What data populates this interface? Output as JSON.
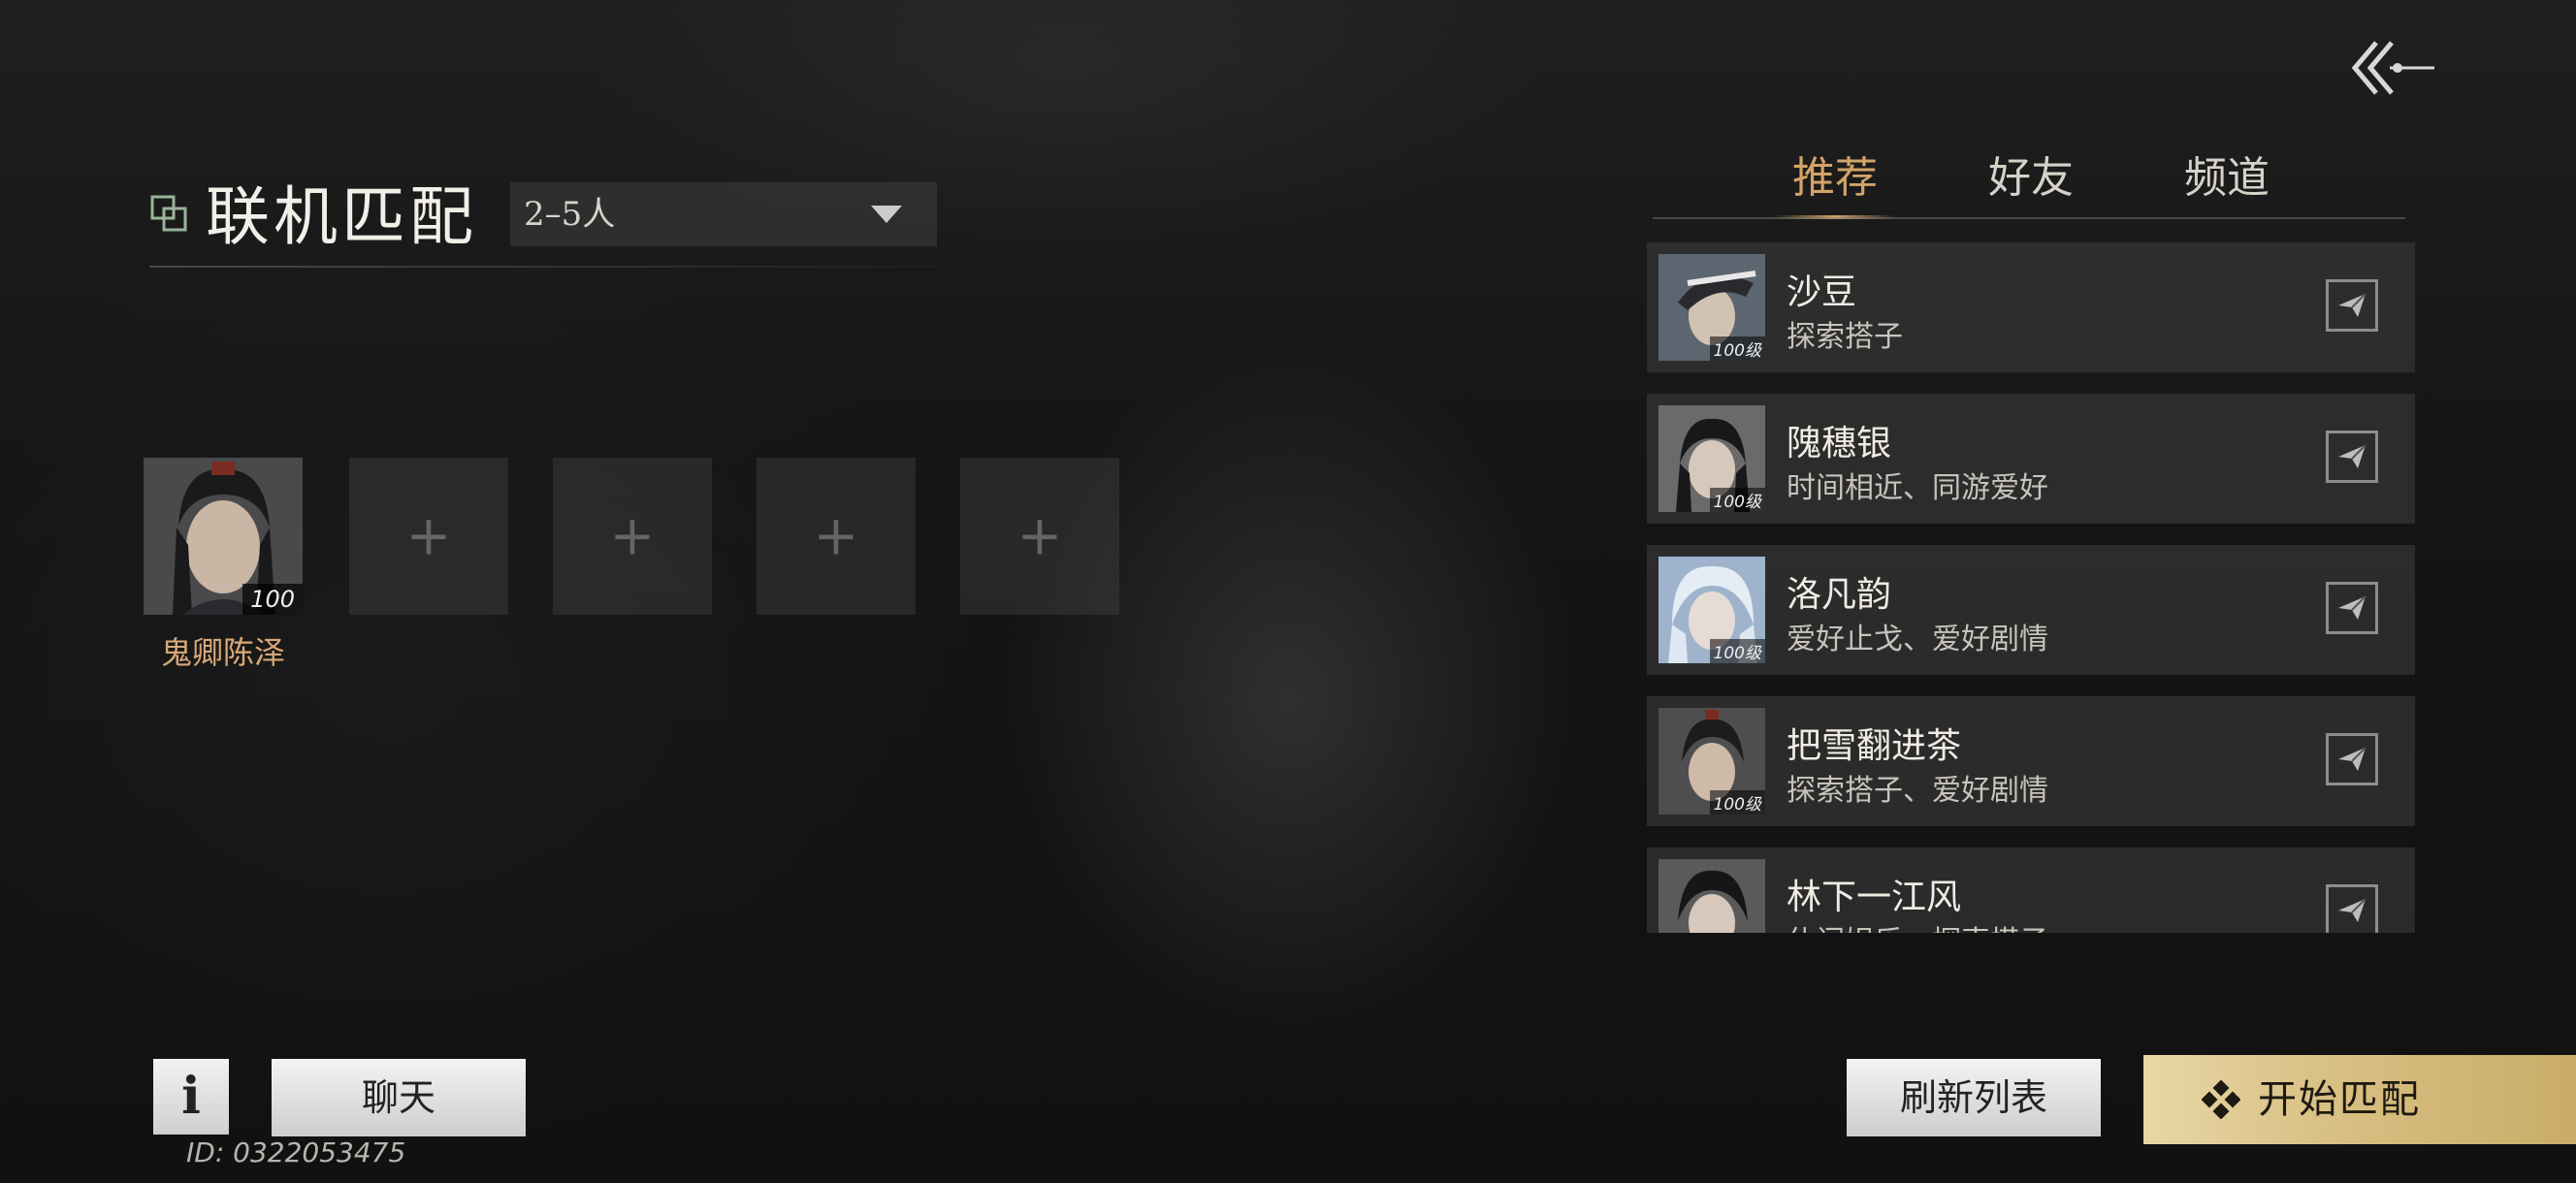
{
  "mode": {
    "title": "联机匹配",
    "party_size": "2–5人"
  },
  "party": {
    "leader_name": "鬼卿陈泽",
    "leader_level": "100",
    "empty_slot_symbol": "+"
  },
  "tabs": [
    {
      "label": "推荐",
      "active": true
    },
    {
      "label": "好友",
      "active": false
    },
    {
      "label": "频道",
      "active": false
    }
  ],
  "recommendations": [
    {
      "name": "沙豆",
      "tags": "探索搭子",
      "level": "100级"
    },
    {
      "name": "隗穗银",
      "tags": "时间相近、同游爱好",
      "level": "100级"
    },
    {
      "name": "洛凡韵",
      "tags": "爱好止戈、爱好剧情",
      "level": "100级"
    },
    {
      "name": "把雪翻进茶",
      "tags": "探索搭子、爱好剧情",
      "level": "100级"
    },
    {
      "name": "林下一江风",
      "tags": "休闲娱乐、探索搭子",
      "level": ""
    }
  ],
  "footer": {
    "info_label": "i",
    "chat_label": "聊天",
    "refresh_label": "刷新列表",
    "start_label": "开始匹配",
    "user_id": "ID: 0322053475"
  },
  "colors": {
    "accent_gold": "#d2a468",
    "player_name": "#d9a878",
    "start_button": "#d8bf82"
  }
}
